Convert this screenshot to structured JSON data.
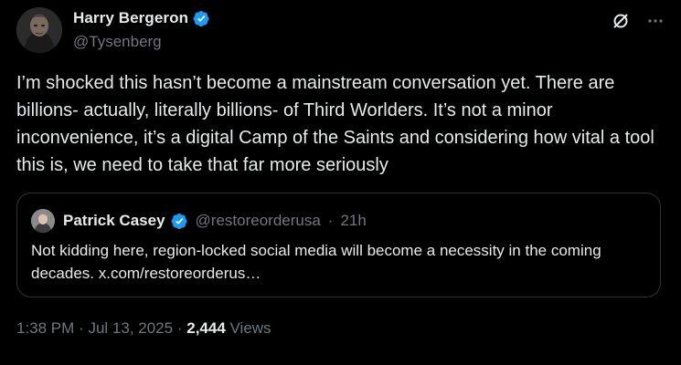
{
  "tweet": {
    "author_name": "Harry Bergeron",
    "author_handle": "@Tysenberg",
    "text": "I’m shocked this hasn’t become a mainstream conversation yet. There are billions- actually, literally billions- of Third Worlders. It’s not a minor inconvenience, it’s a digital Camp of the Saints and considering how vital a tool this is, we need to take that far more seriously",
    "time": "1:38 PM",
    "sep1": "·",
    "date": "Jul 13, 2025",
    "sep2": "·",
    "views_count": "2,444",
    "views_label": "Views",
    "top_icons": [
      "grok-icon",
      "more-icon"
    ]
  },
  "quote": {
    "author_name": "Patrick Casey",
    "author_handle": "@restoreorderusa",
    "sep": "·",
    "time_ago": "21h",
    "text": "Not kidding here, region-locked social media will become a necessity in the coming decades. x.com/restoreorderus…"
  },
  "colors": {
    "background": "#000000",
    "text": "#e7e9ea",
    "secondary_text": "#71767b",
    "border": "#2f3336",
    "verified": "#1d9bf0"
  }
}
